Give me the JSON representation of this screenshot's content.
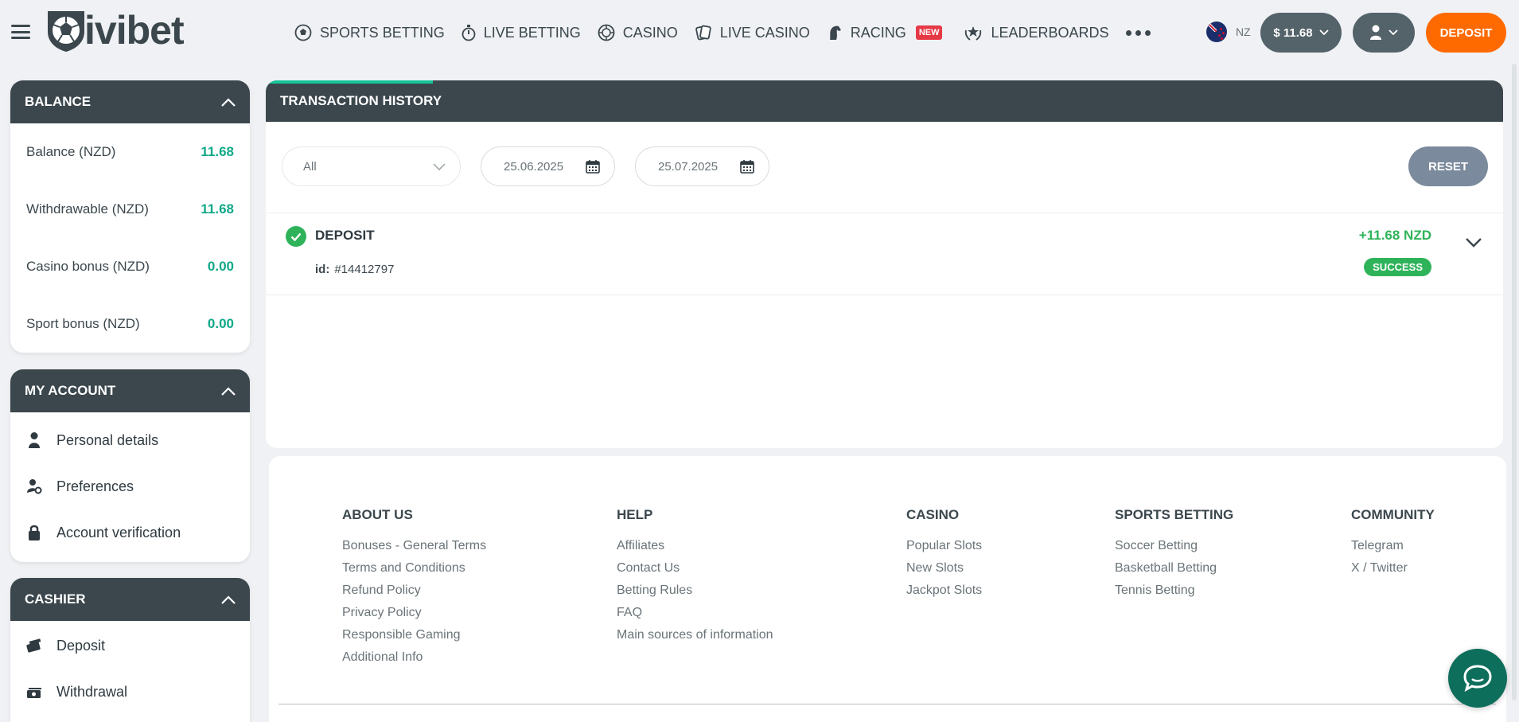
{
  "brand": {
    "name": "ivibet"
  },
  "nav": [
    {
      "label": "SPORTS BETTING",
      "icon": "soccer-ball-icon"
    },
    {
      "label": "LIVE BETTING",
      "icon": "stopwatch-icon"
    },
    {
      "label": "CASINO",
      "icon": "roulette-icon"
    },
    {
      "label": "LIVE CASINO",
      "icon": "cards-icon"
    },
    {
      "label": "RACING",
      "icon": "horse-icon",
      "badge": "NEW"
    },
    {
      "label": "LEADERBOARDS",
      "icon": "laurel-icon"
    }
  ],
  "header": {
    "region": "NZ",
    "balance": "$ 11.68",
    "deposit_label": "DEPOSIT"
  },
  "balance_panel": {
    "title": "BALANCE",
    "rows": [
      {
        "label": "Balance (NZD)",
        "value": "11.68"
      },
      {
        "label": "Withdrawable (NZD)",
        "value": "11.68"
      },
      {
        "label": "Casino bonus (NZD)",
        "value": "0.00"
      },
      {
        "label": "Sport bonus (NZD)",
        "value": "0.00"
      }
    ]
  },
  "account_panel": {
    "title": "MY ACCOUNT",
    "items": [
      "Personal details",
      "Preferences",
      "Account verification"
    ]
  },
  "cashier_panel": {
    "title": "CASHIER",
    "items": [
      "Deposit",
      "Withdrawal"
    ]
  },
  "transactions": {
    "title": "TRANSACTION HISTORY",
    "filter_type": "All",
    "date_from": "25.06.2025",
    "date_to": "25.07.2025",
    "reset_label": "RESET",
    "items": [
      {
        "type": "DEPOSIT",
        "id_label": "id:",
        "id": "#14412797",
        "amount": "+11.68 NZD",
        "status": "SUCCESS"
      }
    ]
  },
  "footer": {
    "columns": [
      {
        "title": "ABOUT US",
        "links": [
          "Bonuses - General Terms",
          "Terms and Conditions",
          "Refund Policy",
          "Privacy Policy",
          "Responsible Gaming",
          "Additional Info"
        ]
      },
      {
        "title": "HELP",
        "links": [
          "Affiliates",
          "Contact Us",
          "Betting Rules",
          "FAQ",
          "Main sources of information"
        ]
      },
      {
        "title": "CASINO",
        "links": [
          "Popular Slots",
          "New Slots",
          "Jackpot Slots"
        ]
      },
      {
        "title": "SPORTS BETTING",
        "links": [
          "Soccer Betting",
          "Basketball Betting",
          "Tennis Betting"
        ]
      },
      {
        "title": "COMMUNITY",
        "links": [
          "Telegram",
          "X / Twitter"
        ]
      }
    ]
  },
  "colors": {
    "accent": "#18c49a",
    "deposit": "#ff6a00",
    "dark": "#3b474d",
    "success": "#2fb35a"
  }
}
